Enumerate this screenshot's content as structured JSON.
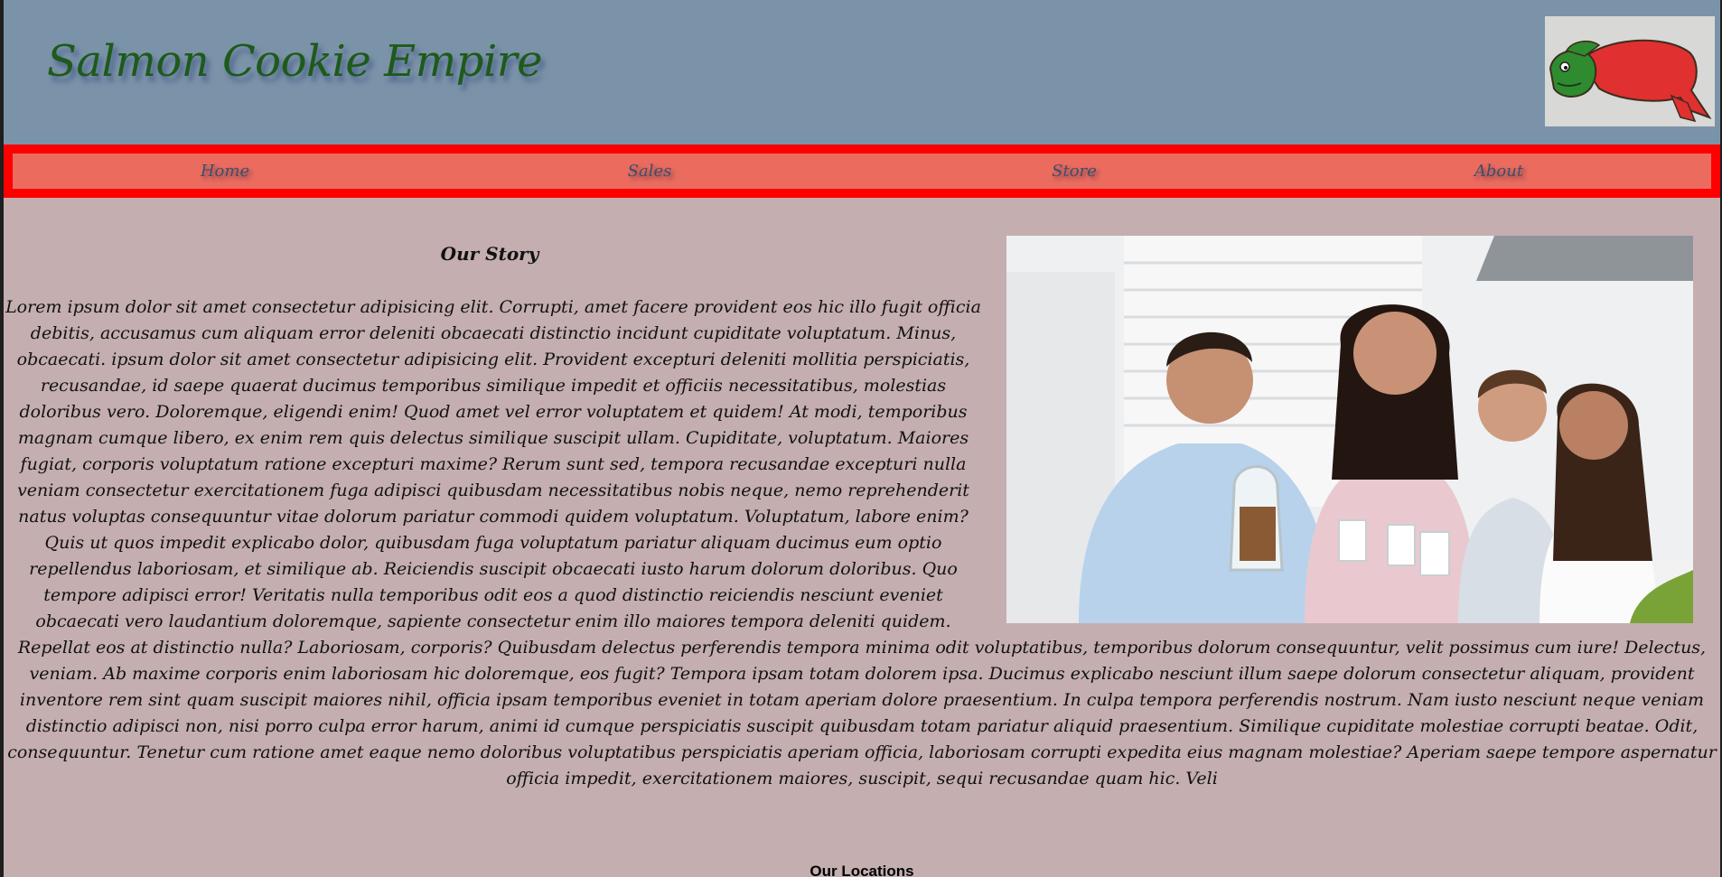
{
  "header": {
    "site_title": "Salmon Cookie Empire",
    "logo_icon": "salmon-cookie-logo"
  },
  "nav": {
    "items": [
      {
        "label": "Home"
      },
      {
        "label": "Sales"
      },
      {
        "label": "Store"
      },
      {
        "label": "About"
      }
    ]
  },
  "main": {
    "story_title": "Our Story",
    "story_body": "Lorem ipsum dolor sit amet consectetur adipisicing elit. Corrupti, amet facere provident eos hic illo fugit officia debitis, accusamus cum aliquam error deleniti obcaecati distinctio incidunt cupiditate voluptatum. Minus, obcaecati. ipsum dolor sit amet consectetur adipisicing elit. Provident excepturi deleniti mollitia perspiciatis, recusandae, id saepe quaerat ducimus temporibus similique impedit et officiis necessitatibus, molestias doloribus vero. Doloremque, eligendi enim! Quod amet vel error voluptatem et quidem! At modi, temporibus magnam cumque libero, ex enim rem quis delectus similique suscipit ullam. Cupiditate, voluptatum. Maiores fugiat, corporis voluptatum ratione excepturi maxime? Rerum sunt sed, tempora recusandae excepturi nulla veniam consectetur exercitationem fuga adipisci quibusdam necessitatibus nobis neque, nemo reprehenderit natus voluptas consequuntur vitae dolorum pariatur commodi quidem voluptatum. Voluptatum, labore enim? Quis ut quos impedit explicabo dolor, quibusdam fuga voluptatum pariatur aliquam ducimus eum optio repellendus laboriosam, et similique ab. Reiciendis suscipit obcaecati iusto harum dolorum doloribus. Quo tempore adipisci error! Veritatis nulla temporibus odit eos a quod distinctio reiciendis nesciunt eveniet obcaecati vero laudantium doloremque, sapiente consectetur enim illo maiores tempora deleniti quidem. Repellat eos at distinctio nulla? Laboriosam, corporis? Quibusdam delectus perferendis tempora minima odit voluptatibus, temporibus dolorum consequuntur, velit possimus cum iure! Delectus, veniam. Ab maxime corporis enim laboriosam hic doloremque, eos fugit? Tempora ipsam totam dolorem ipsa. Ducimus explicabo nesciunt illum saepe dolorum consectetur aliquam, provident inventore rem sint quam suscipit maiores nihil, officia ipsam temporibus eveniet in totam aperiam dolore praesentium. In culpa tempora perferendis nostrum. Nam iusto nesciunt neque veniam distinctio adipisci non, nisi porro culpa error harum, animi id cumque perspiciatis suscipit quibusdam totam pariatur aliquid praesentium. Similique cupiditate molestiae corrupti beatae. Odit, consequuntur. Tenetur cum ratione amet eaque nemo doloribus voluptatibus perspiciatis aperiam officia, laboriosam corrupti expedita eius magnam molestiae? Aperiam saepe tempore aspernatur officia impedit, exercitationem maiores, suscipit, sequi recusandae quam hic. Veli",
    "story_image": "family-kitchen-photo",
    "locations_title": "Our Locations"
  },
  "colors": {
    "header_bg": "#7b93a8",
    "title_green": "#1e5a1a",
    "nav_border": "#ff0000",
    "nav_bg": "#eb6b5f",
    "page_bg": "#c4aeb0"
  }
}
